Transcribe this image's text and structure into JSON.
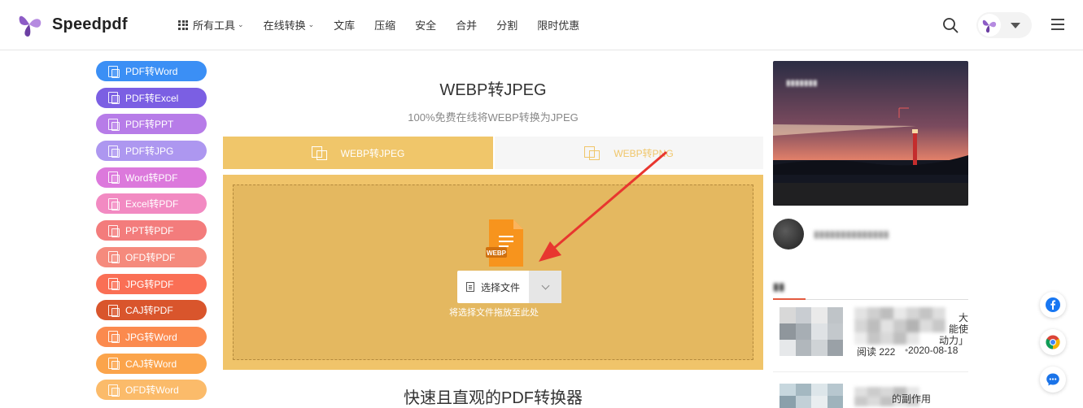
{
  "header": {
    "logo_text": "Speedpdf",
    "nav": [
      {
        "label": "所有工具",
        "dropdown": true,
        "grid": true
      },
      {
        "label": "在线转换",
        "dropdown": true,
        "grid": false
      },
      {
        "label": "文库",
        "dropdown": false,
        "grid": false
      },
      {
        "label": "压缩",
        "dropdown": false,
        "grid": false
      },
      {
        "label": "安全",
        "dropdown": false,
        "grid": false
      },
      {
        "label": "合并",
        "dropdown": false,
        "grid": false
      },
      {
        "label": "分割",
        "dropdown": false,
        "grid": false
      },
      {
        "label": "限时优惠",
        "dropdown": false,
        "grid": false
      }
    ],
    "brand_color": "#7b4fb0"
  },
  "sidebar": {
    "items": [
      {
        "label": "PDF转Word",
        "color": "#3b8ff5"
      },
      {
        "label": "PDF转Excel",
        "color": "#7b5fe3"
      },
      {
        "label": "PDF转PPT",
        "color": "#b77ce8"
      },
      {
        "label": "PDF转JPG",
        "color": "#ad97f0"
      },
      {
        "label": "Word转PDF",
        "color": "#dc79dc"
      },
      {
        "label": "Excel转PDF",
        "color": "#f28ac2"
      },
      {
        "label": "PPT转PDF",
        "color": "#f37c7c"
      },
      {
        "label": "OFD转PDF",
        "color": "#f58a7d"
      },
      {
        "label": "JPG转PDF",
        "color": "#fa6f55"
      },
      {
        "label": "CAJ转PDF",
        "color": "#d9552c"
      },
      {
        "label": "JPG转Word",
        "color": "#fb8a4e"
      },
      {
        "label": "CAJ转Word",
        "color": "#fba44b"
      },
      {
        "label": "OFD转Word",
        "color": "#fbbb6a"
      }
    ]
  },
  "main": {
    "title": "WEBP转JPEG",
    "subtitle": "100%免费在线将WEBP转换为JPEG",
    "tabs": [
      {
        "label": "WEBP转JPEG",
        "active": true
      },
      {
        "label": "WEBP转PNG",
        "active": false
      }
    ],
    "file_badge": "WEBP",
    "select_label": "选择文件",
    "drop_hint": "将选择文件拖放至此处",
    "bottom_title": "快速且直观的PDF转换器",
    "accent_color": "#f0c66a"
  },
  "right": {
    "cards": [
      {
        "title_visible": "大\n能使\n动力」",
        "views": "阅读 222",
        "date": "2020-08-18"
      },
      {
        "title_visible": "的副作用",
        "views": "",
        "date": ""
      }
    ]
  }
}
